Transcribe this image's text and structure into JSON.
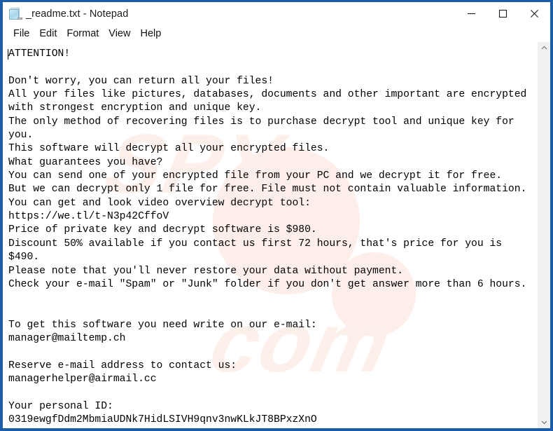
{
  "window": {
    "title": "_readme.txt - Notepad",
    "icon": "notepad-document-icon",
    "border_color": "#1c5ca8",
    "controls": [
      {
        "name": "minimize",
        "glyph": "minimize-icon"
      },
      {
        "name": "maximize",
        "glyph": "maximize-icon"
      },
      {
        "name": "close",
        "glyph": "close-icon"
      }
    ]
  },
  "menubar": {
    "items": [
      {
        "label": "File"
      },
      {
        "label": "Edit"
      },
      {
        "label": "Format"
      },
      {
        "label": "View"
      },
      {
        "label": "Help"
      }
    ]
  },
  "document": {
    "filename": "_readme.txt",
    "caret_visible": true,
    "lines": [
      "ATTENTION!",
      "",
      "Don't worry, you can return all your files!",
      "All your files like pictures, databases, documents and other important are encrypted",
      "with strongest encryption and unique key.",
      "The only method of recovering files is to purchase decrypt tool and unique key for",
      "you.",
      "This software will decrypt all your encrypted files.",
      "What guarantees you have?",
      "You can send one of your encrypted file from your PC and we decrypt it for free.",
      "But we can decrypt only 1 file for free. File must not contain valuable information.",
      "You can get and look video overview decrypt tool:",
      "https://we.tl/t-N3p42CffoV",
      "Price of private key and decrypt software is $980.",
      "Discount 50% available if you contact us first 72 hours, that's price for you is",
      "$490.",
      "Please note that you'll never restore your data without payment.",
      "Check your e-mail \"Spam\" or \"Junk\" folder if you don't get answer more than 6 hours.",
      "",
      "",
      "To get this software you need write on our e-mail:",
      "manager@mailtemp.ch",
      "",
      "Reserve e-mail address to contact us:",
      "managerhelper@airmail.cc",
      "",
      "Your personal ID:",
      "0319ewgfDdm2MbmiaUDNk7HidLSIVH9qnv3nwKLkJT8BPxzXnO"
    ],
    "key_values": {
      "video_url": "https://we.tl/t-N3p42CffoV",
      "price": "$980",
      "discount_price": "$490",
      "discount_percent": "50%",
      "discount_window": "72 hours",
      "reply_window": "6 hours",
      "free_decrypt_files": "1",
      "primary_email": "manager@mailtemp.ch",
      "reserve_email": "managerhelper@airmail.cc",
      "personal_id": "0319ewgfDdm2MbmiaUDNk7HidLSIVH9qnv3nwKLkJT8BPxzXnO"
    }
  },
  "watermark": {
    "text_1": "SPY",
    "text_2": "com"
  },
  "scrollbar": {
    "up_label": "scroll-up",
    "down_label": "scroll-down"
  }
}
